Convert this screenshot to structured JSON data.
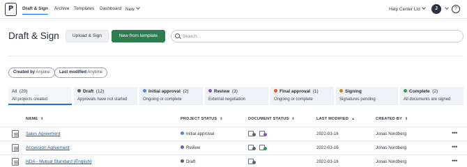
{
  "nav": {
    "logo": "P",
    "items": [
      "Draft & Sign",
      "Archive",
      "Templates",
      "Dashboard",
      "New"
    ],
    "company": "Help Center Ltd",
    "avatar": "J",
    "help": "?"
  },
  "header": {
    "title": "Draft & Sign",
    "upload_label": "Upload & Sign",
    "new_template_label": "New from template",
    "search_placeholder": "Search..."
  },
  "filters": [
    {
      "label": "Created by",
      "value": "Anyone"
    },
    {
      "label": "Last modified",
      "value": "Anytime"
    }
  ],
  "tabs": [
    {
      "label": "All",
      "count": "(20)",
      "sub": "All projects created",
      "color": ""
    },
    {
      "label": "Draft",
      "count": "(12)",
      "sub": "Approvals have not started",
      "color": "#5a6270"
    },
    {
      "label": "Initial approval",
      "count": "(2)",
      "sub": "Ongoing or complete",
      "color": "#3a8ee6"
    },
    {
      "label": "Review",
      "count": "(3)",
      "sub": "External negotiation",
      "color": "#7e57c2"
    },
    {
      "label": "Final approval",
      "count": "(1)",
      "sub": "Ongoing or complete",
      "color": "#e4572e"
    },
    {
      "label": "Signing",
      "count": "",
      "sub": "Signatures pending",
      "color": "#c78a1a"
    },
    {
      "label": "Complete",
      "count": "(2)",
      "sub": "All documents are signed",
      "color": "#2e9e5b"
    }
  ],
  "table": {
    "columns": [
      "NAME",
      "PROJECT STATUS",
      "DOCUMENT STATUS",
      "LAST MODIFIED",
      "CREATED BY"
    ],
    "rows": [
      {
        "name": "Sales Agreement",
        "status": "Initial approval",
        "status_color": "#3a8ee6",
        "doc_dots": [
          "#5a6270",
          "#7e57c2"
        ],
        "modified": "2022-03-16",
        "creator": "Jonas Nordberg"
      },
      {
        "name": "Accession Agreement",
        "status": "Review",
        "status_color": "#7e57c2",
        "doc_dots": [
          "#5a6270",
          "#2e9e5b"
        ],
        "modified": "2022-03-16",
        "creator": "Jonas Nordberg"
      },
      {
        "name": "NDA - Mutual Standard (English)",
        "status": "Draft",
        "status_color": "#5a6270",
        "doc_dots": [
          "#5a6270"
        ],
        "modified": "2022-03-16",
        "creator": "Jonas Nordberg"
      }
    ]
  }
}
